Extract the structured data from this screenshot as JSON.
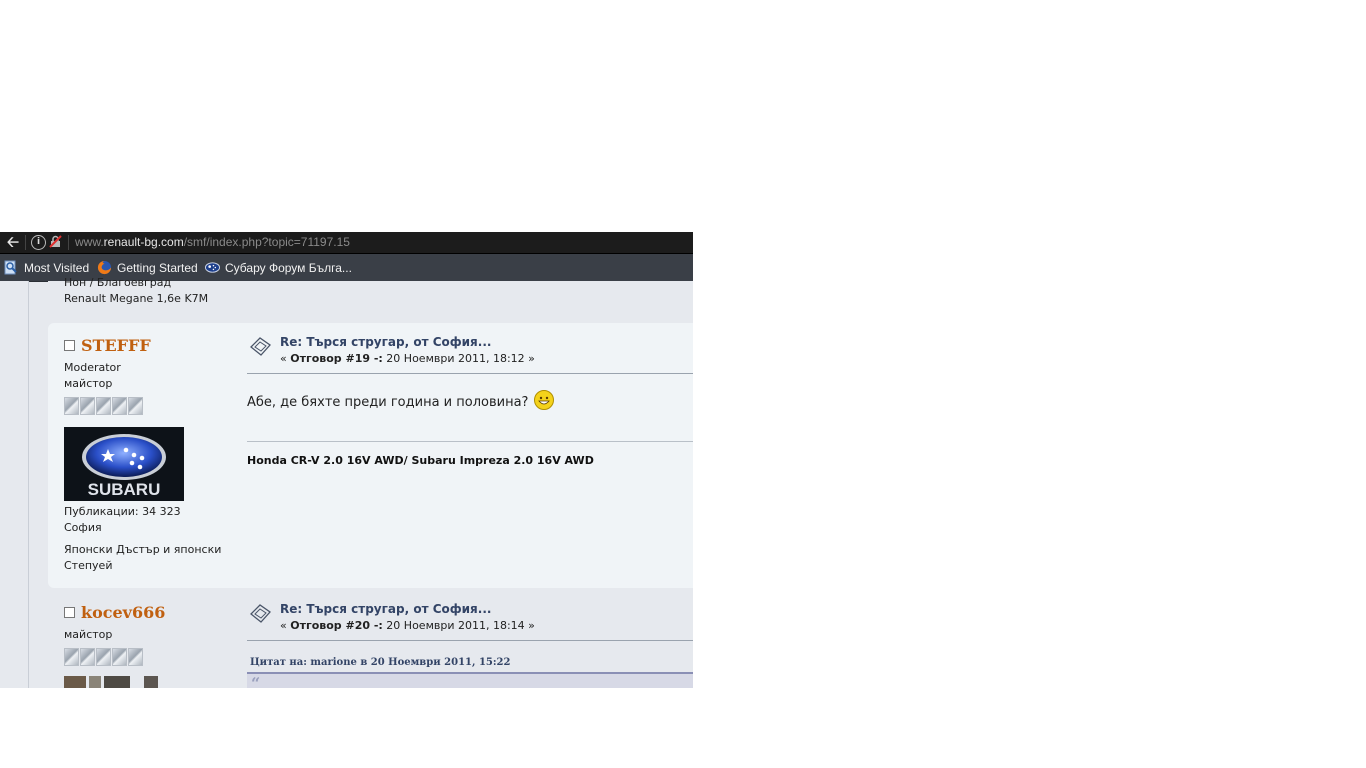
{
  "browser": {
    "url_domain_prefix": "www.",
    "url_domain": "renault-bg.com",
    "url_path": "/smf/index.php?topic=71197.15",
    "bookmarks": [
      {
        "label": "Most Visited",
        "icon": "magnifier-page-icon"
      },
      {
        "label": "Getting Started",
        "icon": "firefox-icon"
      },
      {
        "label": "Субару Форум Бълга...",
        "icon": "subaru-logo-icon"
      }
    ]
  },
  "prev_post": {
    "cut_text": "Нон / Благоевград",
    "car": "Renault Megane 1,6e K7M"
  },
  "posts": [
    {
      "username": "STEFFF",
      "group": "Moderator",
      "rank": "майстор",
      "star_count": 5,
      "avatar_text": "SUBARU",
      "posts_label": "Публикации: 34 323",
      "location": "София",
      "custom_line1": "Японски Дъстър и японски",
      "custom_line2": "Степуей",
      "title": "Re: Търся стругар, от София...",
      "meta_prefix": "« ",
      "reply_label": "Отговор #19 -:",
      "date": " 20 Ноември 2011, 18:12 »",
      "body": "Абе, де бяхте преди година и половина?",
      "signature": "Honda CR-V 2.0 16V AWD/ Subaru Impreza 2.0 16V AWD"
    },
    {
      "username": "kocev666",
      "rank": "майстор",
      "star_count": 5,
      "title": "Re: Търся стругар, от София...",
      "meta_prefix": "« ",
      "reply_label": "Отговор #20 -:",
      "date": " 20 Ноември 2011, 18:14 »",
      "quote_header": "Цитат на: marione в 20 Ноември 2011, 15:22"
    }
  ],
  "colors": {
    "username": "#c06010",
    "title_link": "#334466",
    "post_bg_light": "#f0f4f7",
    "post_bg_dark": "#e6e9ee"
  }
}
